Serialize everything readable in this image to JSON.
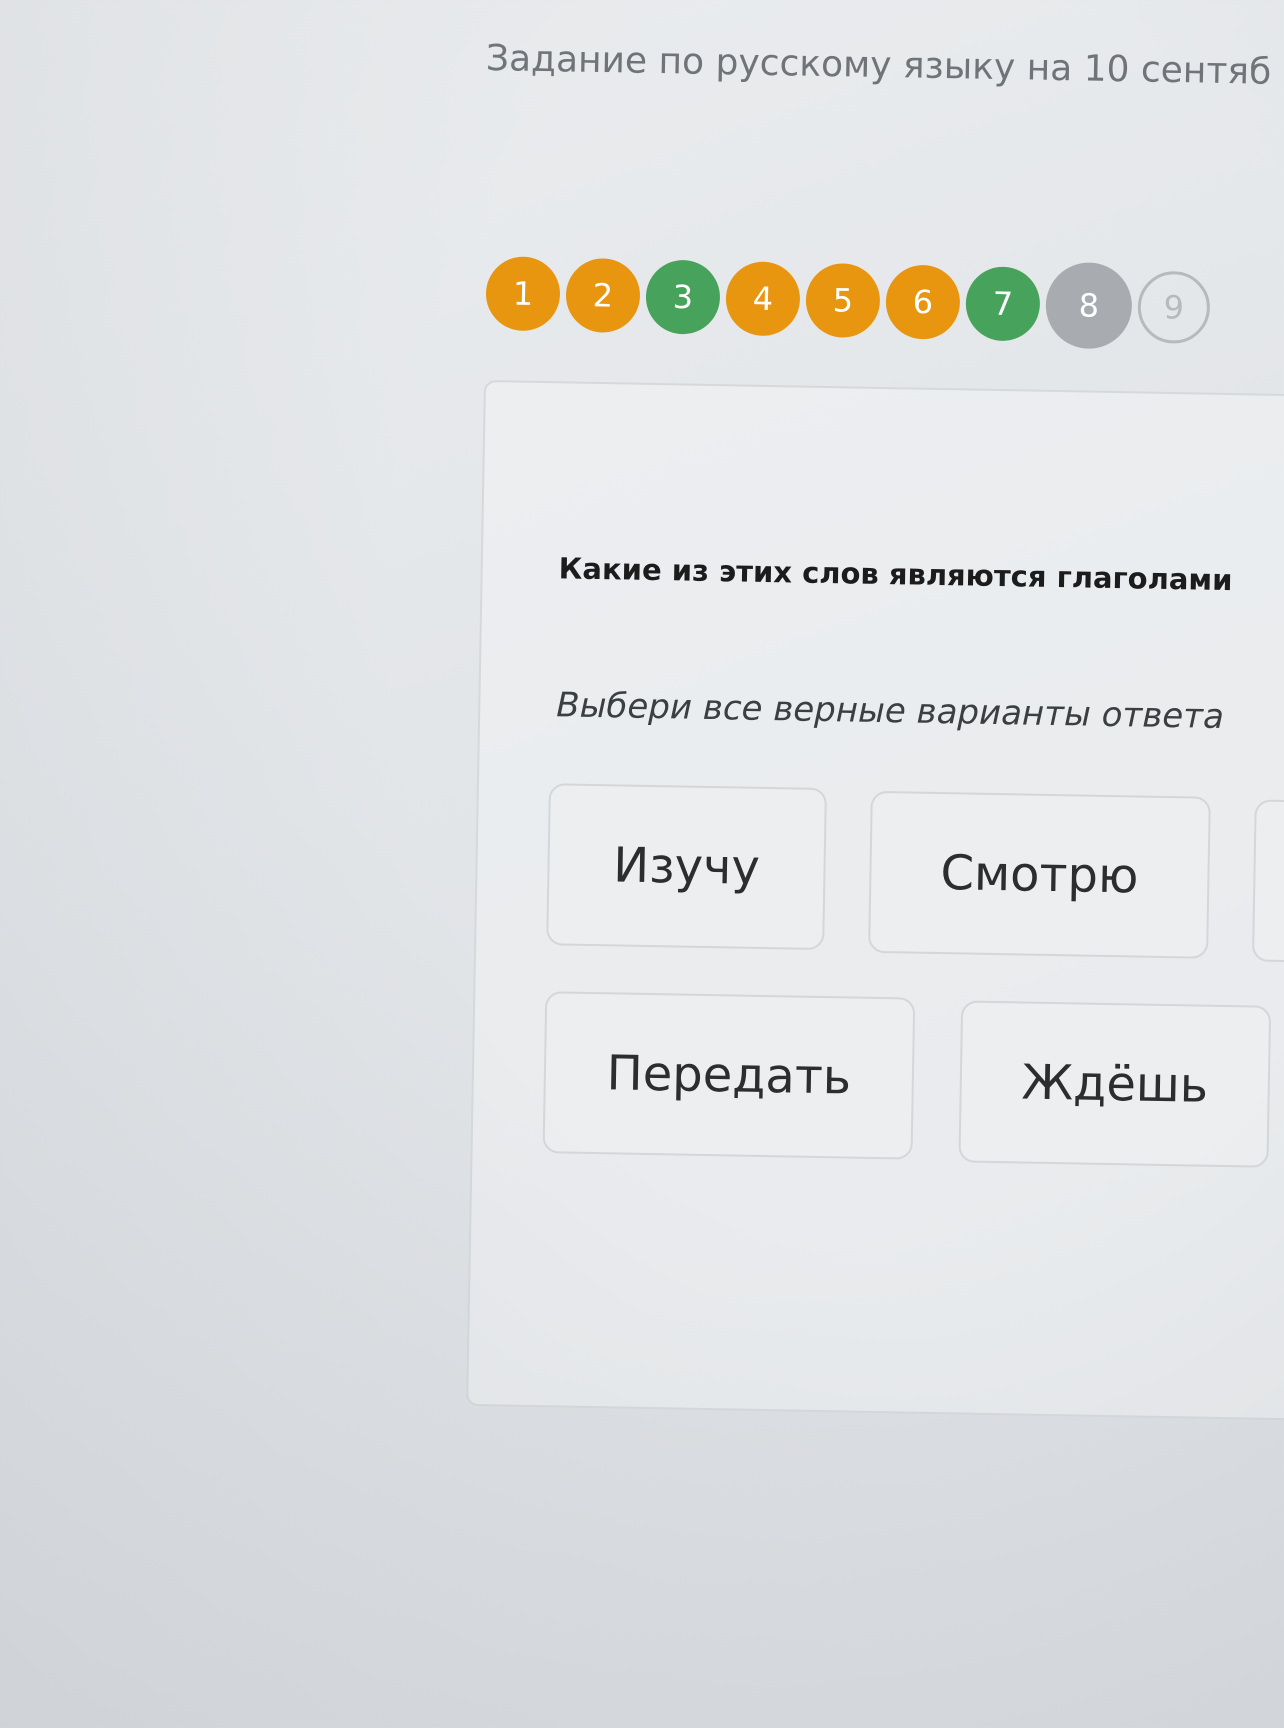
{
  "page": {
    "title": "Задание по русскому языку на 10 сентяб"
  },
  "progress": {
    "steps": [
      {
        "label": "1",
        "state": "answered",
        "color": "#e8960f"
      },
      {
        "label": "2",
        "state": "answered",
        "color": "#e8960f"
      },
      {
        "label": "3",
        "state": "correct",
        "color": "#47a35b"
      },
      {
        "label": "4",
        "state": "answered",
        "color": "#e8960f"
      },
      {
        "label": "5",
        "state": "answered",
        "color": "#e8960f"
      },
      {
        "label": "6",
        "state": "answered",
        "color": "#e8960f"
      },
      {
        "label": "7",
        "state": "correct",
        "color": "#47a35b"
      },
      {
        "label": "8",
        "state": "current",
        "color": "#a8abaf"
      },
      {
        "label": "9",
        "state": "unanswered",
        "color": "#b7babd"
      }
    ]
  },
  "task": {
    "question": "Какие из этих слов являются глаголами",
    "hint": "Выбери все верные варианты ответа",
    "options": [
      {
        "label": "Изучу"
      },
      {
        "label": "Смотрю"
      },
      {
        "label": ""
      },
      {
        "label": "Передать"
      },
      {
        "label": "Ждёшь"
      }
    ]
  }
}
